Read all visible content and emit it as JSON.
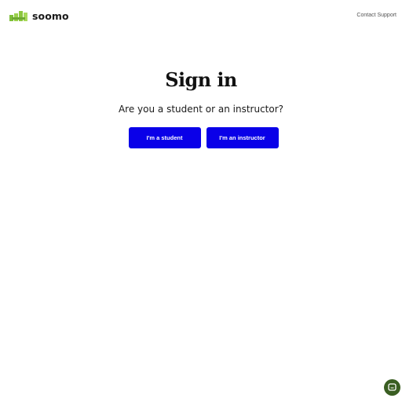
{
  "header": {
    "logo_text": "soomo",
    "logo_icon": "soomo-logo-icon",
    "contact_label": "Contact Support"
  },
  "main": {
    "title": "Sign in",
    "subtitle": "Are you a student or an instructor?",
    "student_button_label": "I'm a student",
    "instructor_button_label": "I'm an instructor"
  },
  "chat_widget": {
    "icon": "chat-icon"
  },
  "colors": {
    "button_bg": "#0a00e8",
    "logo_green": "#8cc63f",
    "chat_bg": "#3a5e22"
  }
}
